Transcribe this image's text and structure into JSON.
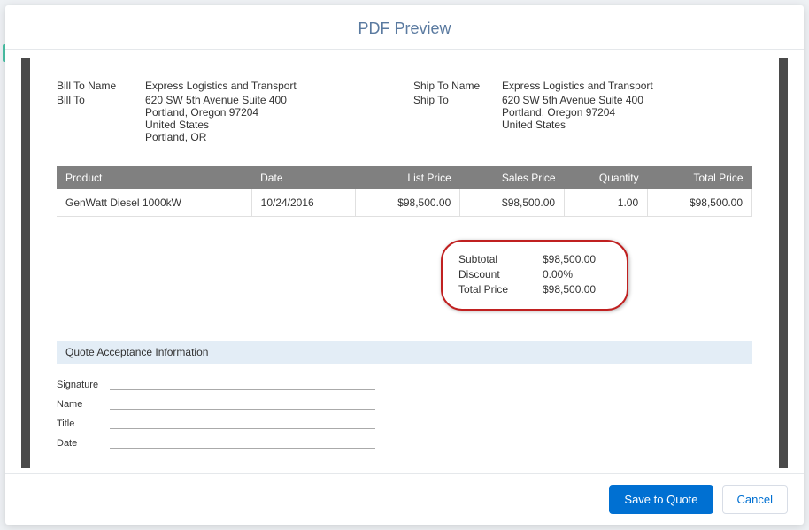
{
  "modal": {
    "title": "PDF Preview"
  },
  "billToNameLabel": "Bill To Name",
  "billToLabel": "Bill To",
  "shipToNameLabel": "Ship To Name",
  "shipToLabel": "Ship To",
  "billToName": "Express Logistics and Transport",
  "billTo": {
    "line1": "620 SW 5th Avenue Suite 400",
    "line2": "Portland, Oregon 97204",
    "line3": "United States",
    "line4": "Portland, OR"
  },
  "shipToName": "Express Logistics and Transport",
  "shipTo": {
    "line1": "620 SW 5th Avenue Suite 400",
    "line2": "Portland, Oregon 97204",
    "line3": "United States"
  },
  "columns": {
    "product": "Product",
    "date": "Date",
    "listPrice": "List Price",
    "salesPrice": "Sales Price",
    "quantity": "Quantity",
    "totalPrice": "Total Price"
  },
  "rows": [
    {
      "product": "GenWatt Diesel 1000kW",
      "date": "10/24/2016",
      "listPrice": "$98,500.00",
      "salesPrice": "$98,500.00",
      "quantity": "1.00",
      "totalPrice": "$98,500.00"
    }
  ],
  "totals": {
    "subtotalLabel": "Subtotal",
    "subtotal": "$98,500.00",
    "discountLabel": "Discount",
    "discount": "0.00%",
    "totalPriceLabel": "Total Price",
    "totalPrice": "$98,500.00"
  },
  "acceptance": {
    "header": "Quote Acceptance Information",
    "signature": "Signature",
    "name": "Name",
    "title": "Title",
    "date": "Date"
  },
  "footer": {
    "save": "Save to Quote",
    "cancel": "Cancel"
  }
}
